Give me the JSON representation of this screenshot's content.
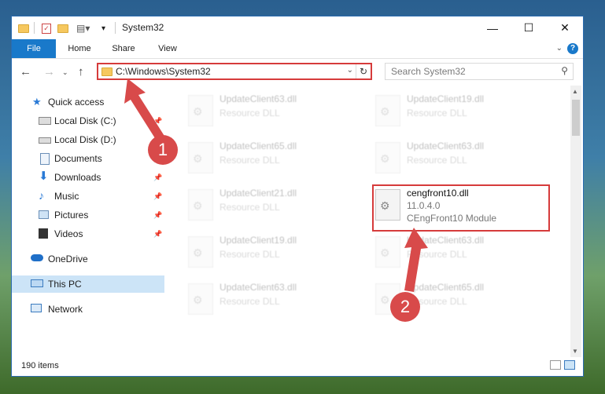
{
  "window": {
    "title": "System32",
    "controls": {
      "minimize": "—",
      "maximize": "☐",
      "close": "✕"
    }
  },
  "ribbon": {
    "tabs": [
      "File",
      "Home",
      "Share",
      "View"
    ],
    "help": "?"
  },
  "address": {
    "path": "C:\\Windows\\System32",
    "search_placeholder": "Search System32"
  },
  "nav": {
    "quick_access": "Quick access",
    "items": [
      {
        "label": "Local Disk (C:)",
        "icon": "drive-icon",
        "pinned": true
      },
      {
        "label": "Local Disk (D:)",
        "icon": "drive-icon",
        "pinned": false
      },
      {
        "label": "Documents",
        "icon": "documents-icon",
        "pinned": true
      },
      {
        "label": "Downloads",
        "icon": "downloads-icon",
        "pinned": true
      },
      {
        "label": "Music",
        "icon": "music-icon",
        "pinned": true
      },
      {
        "label": "Pictures",
        "icon": "pictures-icon",
        "pinned": true
      },
      {
        "label": "Videos",
        "icon": "videos-icon",
        "pinned": true
      }
    ],
    "onedrive": "OneDrive",
    "this_pc": "This PC",
    "network": "Network"
  },
  "files": {
    "left": [
      {
        "name": "UpdateClient63.dll",
        "desc": "Resource DLL"
      },
      {
        "name": "UpdateClient65.dll",
        "desc": "Resource DLL"
      },
      {
        "name": "UpdateClient21.dll",
        "desc": "Resource DLL"
      },
      {
        "name": "UpdateClient19.dll",
        "desc": "Resource DLL"
      },
      {
        "name": "UpdateClient63.dll",
        "desc": "Resource DLL"
      }
    ],
    "right": [
      {
        "name": "UpdateClient19.dll",
        "desc": "Resource DLL"
      },
      {
        "name": "UpdateClient63.dll",
        "desc": "Resource DLL"
      },
      {
        "name": "cengfront10.dll",
        "version": "11.0.4.0",
        "desc": "CEngFront10 Module"
      },
      {
        "name": "UpdateClient63.dll",
        "desc": "Resource DLL"
      },
      {
        "name": "UpdateClient65.dll",
        "desc": "Resource DLL"
      }
    ]
  },
  "status": {
    "count": "190 items"
  },
  "annotations": {
    "marker1": "1",
    "marker2": "2"
  }
}
